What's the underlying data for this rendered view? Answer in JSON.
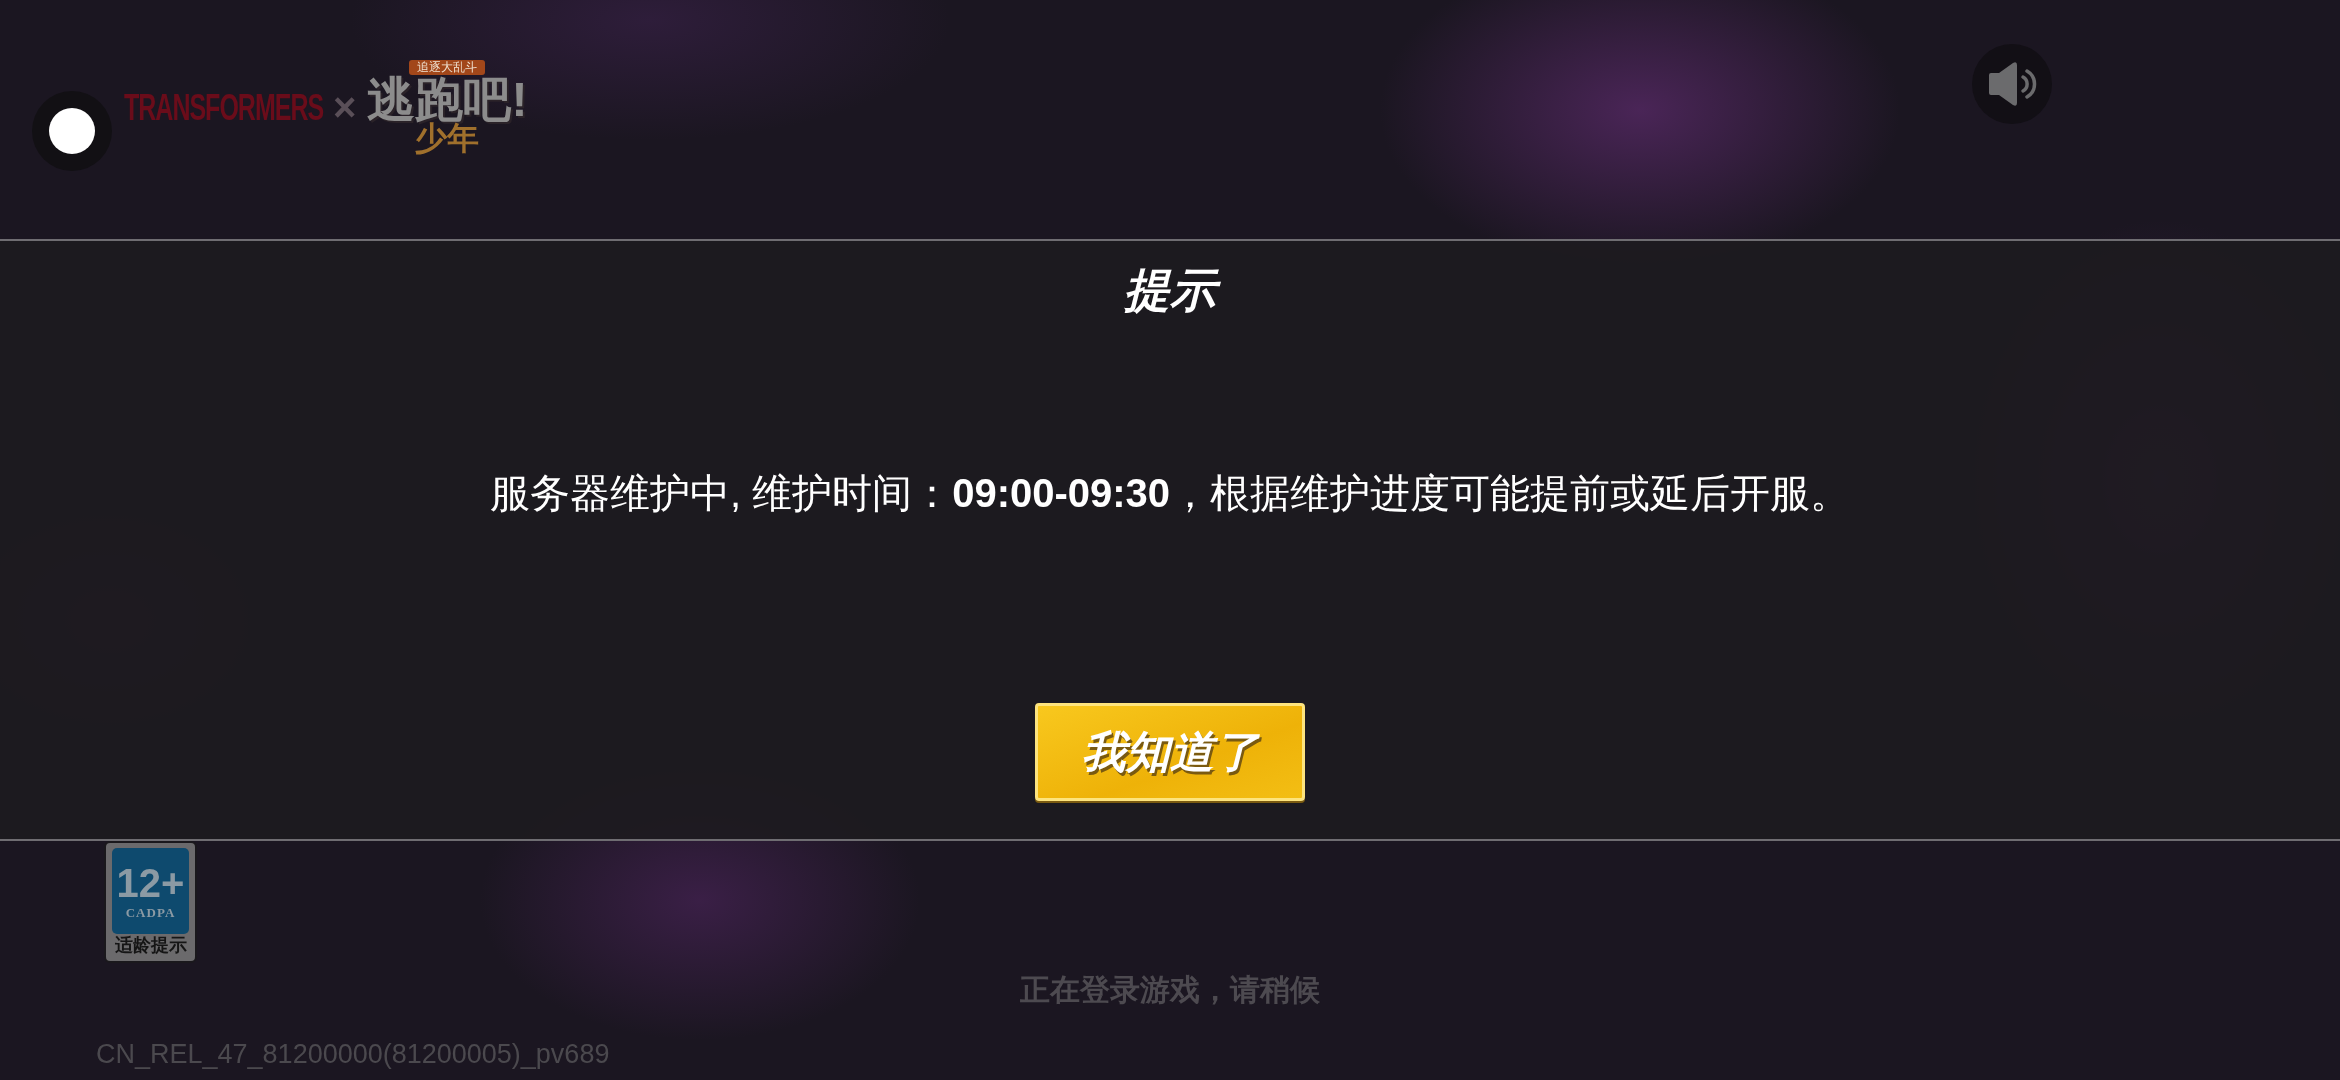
{
  "header": {
    "logo": {
      "brand": "TRANSFORMERS",
      "separator": "×",
      "banner": "追逐大乱斗",
      "title": "逃跑吧!",
      "subtitle": "少年"
    },
    "sound_button": {
      "muted": false
    }
  },
  "dialog": {
    "title": "提示",
    "message": "服务器维护中, 维护时间：**09:00-09:30**，根据维护进度可能提前或延后开服。",
    "button": "我知道了"
  },
  "age_rating": {
    "rating": "12+",
    "organization": "CADPA",
    "label": "适龄提示"
  },
  "status_text": "正在登录游戏，请稍候",
  "version": "CN_REL_47_81200000(81200005)_pv689"
}
